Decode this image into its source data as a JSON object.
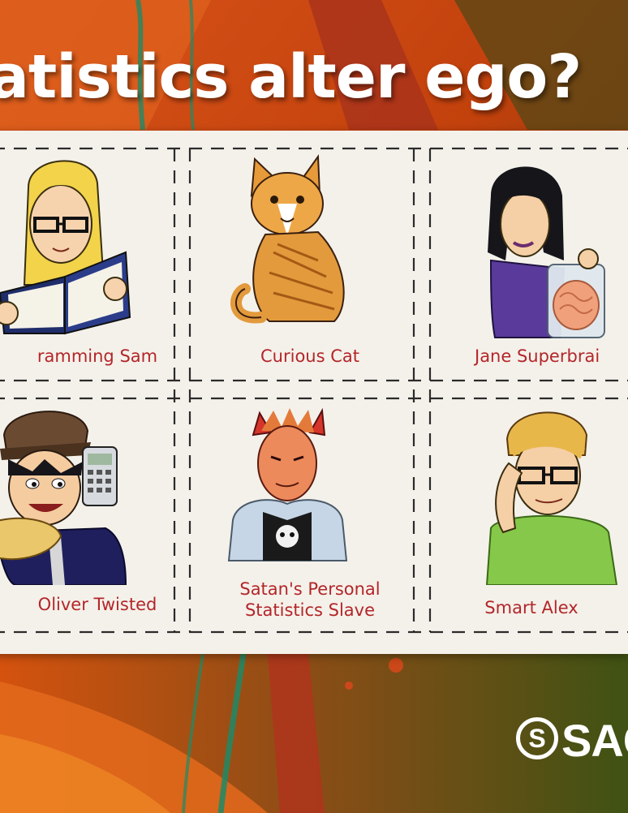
{
  "headline": "atistics alter ego?",
  "characters": [
    {
      "id": "sam",
      "label_lines": [
        "ramming Sam"
      ]
    },
    {
      "id": "cat",
      "label_lines": [
        "Curious Cat"
      ]
    },
    {
      "id": "jane",
      "label_lines": [
        "Jane Superbrai"
      ]
    },
    {
      "id": "oliver",
      "label_lines": [
        "Oliver Twisted"
      ]
    },
    {
      "id": "satan",
      "label_lines": [
        "Satan's Personal",
        "Statistics Slave"
      ]
    },
    {
      "id": "alex",
      "label_lines": [
        "Smart Alex"
      ]
    }
  ],
  "publisher_logo": {
    "mark": "S",
    "text": "SAG"
  },
  "colors": {
    "background": "#c2410c",
    "board": "#f4f1ea",
    "label": "#b3262a",
    "headline": "#ffffff"
  }
}
